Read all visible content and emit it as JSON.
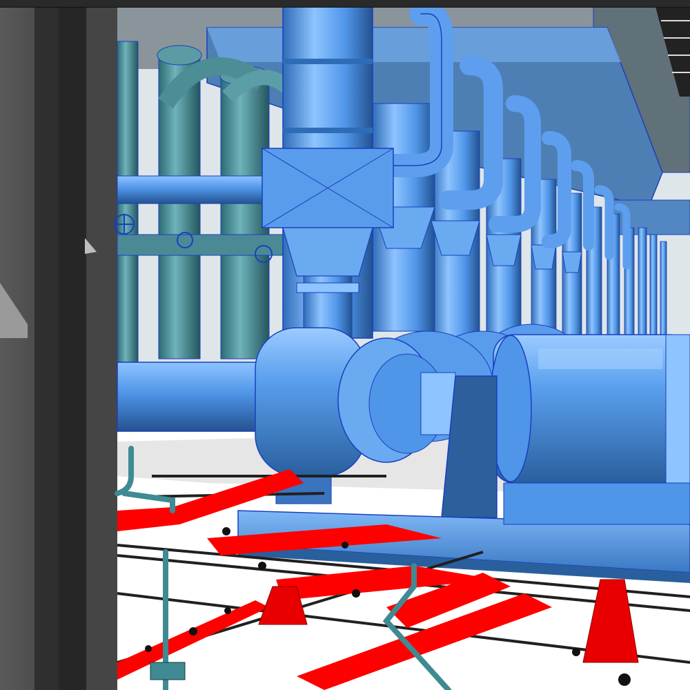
{
  "viewport": {
    "scene": "3d-render",
    "colors": {
      "equipment_blue": "#4f95e8",
      "equipment_highlight": "#8ec4ff",
      "equipment_shadow": "#2a5f9e",
      "outline_blue": "#1a3fbf",
      "pipe_teal": "#3f8a93",
      "fire_red": "#ff0000",
      "floor_white": "#ffffff",
      "floor_grey": "#e8e8e8",
      "column_grey": "#4a4a4a",
      "tray_black": "#202020"
    },
    "icons": [
      "valve-handwheel-icon"
    ]
  }
}
